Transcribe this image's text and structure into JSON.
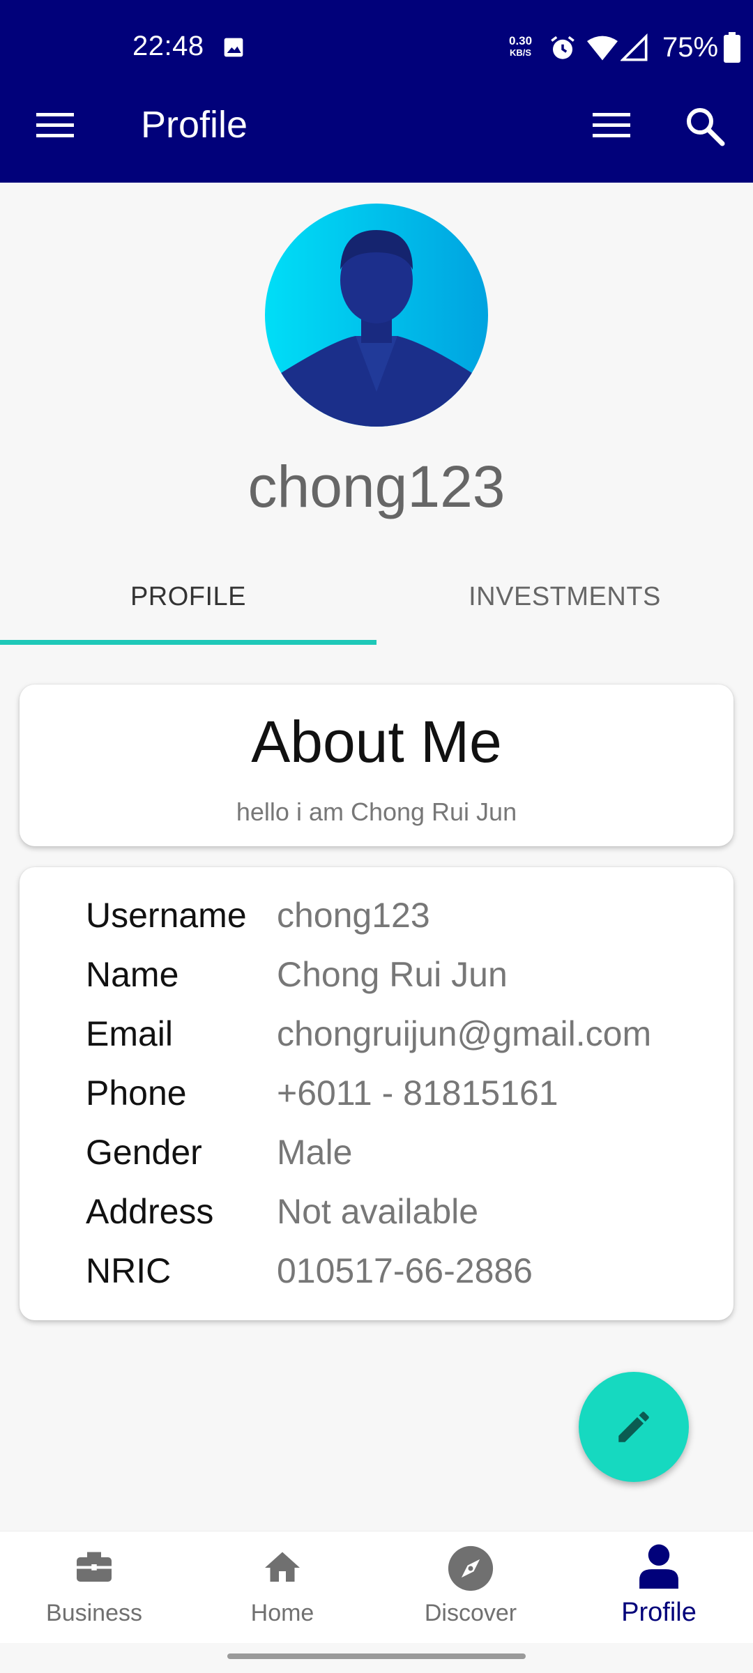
{
  "status_bar": {
    "time": "22:48",
    "net_speed_value": "0.30",
    "net_speed_unit": "KB/S",
    "battery_percent": "75%"
  },
  "appbar": {
    "title": "Profile"
  },
  "profile": {
    "username": "chong123"
  },
  "tabs": [
    {
      "label": "PROFILE",
      "selected": true
    },
    {
      "label": "INVESTMENTS",
      "selected": false
    }
  ],
  "about": {
    "title": "About Me",
    "text": "hello i am Chong Rui Jun"
  },
  "info": [
    {
      "label": "Username",
      "value": "chong123"
    },
    {
      "label": "Name",
      "value": "Chong Rui Jun"
    },
    {
      "label": "Email",
      "value": "chongruijun@gmail.com"
    },
    {
      "label": "Phone",
      "value": "+6011 - 81815161"
    },
    {
      "label": "Gender",
      "value": "Male"
    },
    {
      "label": "Address",
      "value": "Not available"
    },
    {
      "label": "NRIC",
      "value": "010517-66-2886"
    }
  ],
  "bottom_nav": [
    {
      "label": "Business",
      "icon": "briefcase-icon"
    },
    {
      "label": "Home",
      "icon": "home-icon"
    },
    {
      "label": "Discover",
      "icon": "compass-icon"
    },
    {
      "label": "Profile",
      "icon": "person-icon",
      "active": true
    }
  ],
  "colors": {
    "appbar": "#01017a",
    "accent": "#1ec8b8",
    "fab": "#16d9c0"
  }
}
